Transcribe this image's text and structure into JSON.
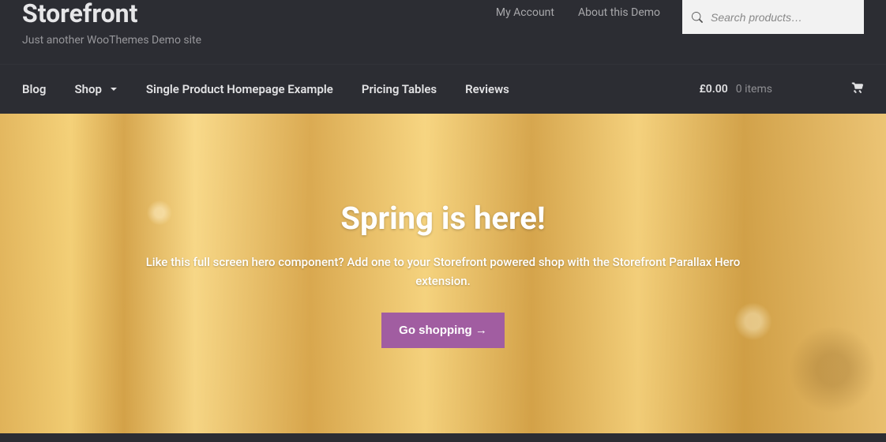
{
  "site": {
    "title": "Storefront",
    "tagline": "Just another WooThemes Demo site"
  },
  "secondary_nav": {
    "my_account": "My Account",
    "about": "About this Demo"
  },
  "search": {
    "placeholder": "Search products…"
  },
  "main_nav": {
    "blog": "Blog",
    "shop": "Shop",
    "single_product": "Single Product Homepage Example",
    "pricing": "Pricing Tables",
    "reviews": "Reviews"
  },
  "cart": {
    "amount": "£0.00",
    "count": "0 items"
  },
  "hero": {
    "title": "Spring is here!",
    "subtitle": "Like this full screen hero component? Add one to your Storefront powered shop with the Storefront Parallax Hero extension.",
    "button": "Go shopping →"
  }
}
